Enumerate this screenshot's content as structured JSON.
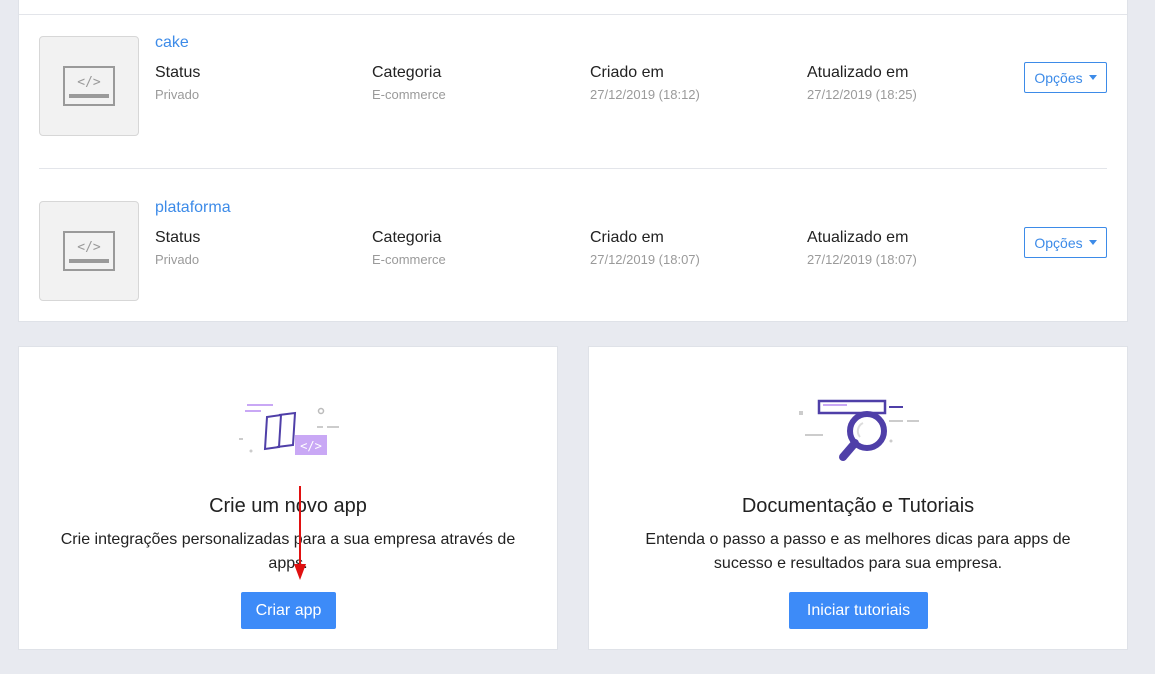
{
  "apps": [
    {
      "name": "cake",
      "status_label": "Status",
      "status_value": "Privado",
      "category_label": "Categoria",
      "category_value": "E-commerce",
      "created_label": "Criado em",
      "created_value": "27/12/2019 (18:12)",
      "updated_label": "Atualizado em",
      "updated_value": "27/12/2019 (18:25)",
      "options_label": "Opções"
    },
    {
      "name": "plataforma",
      "status_label": "Status",
      "status_value": "Privado",
      "category_label": "Categoria",
      "category_value": "E-commerce",
      "created_label": "Criado em",
      "created_value": "27/12/2019 (18:07)",
      "updated_label": "Atualizado em",
      "updated_value": "27/12/2019 (18:07)",
      "options_label": "Opções"
    }
  ],
  "cards": {
    "create": {
      "title": "Crie um novo app",
      "description": "Crie integrações personalizadas para a sua empresa através de apps.",
      "button": "Criar app",
      "icon": "app-code-illustration"
    },
    "docs": {
      "title": "Documentação e Tutoriais",
      "description": "Entenda o passo a passo e as melhores dicas para apps de sucesso e resultados para sua empresa.",
      "button": "Iniciar tutoriais",
      "icon": "magnifier-illustration"
    }
  },
  "colors": {
    "accent": "#3d8be8",
    "button_bg": "#3d8bf8",
    "illustration_purple": "#4f3fa8",
    "illustration_light": "#c9a8f5",
    "annotation_arrow": "#e01010"
  }
}
